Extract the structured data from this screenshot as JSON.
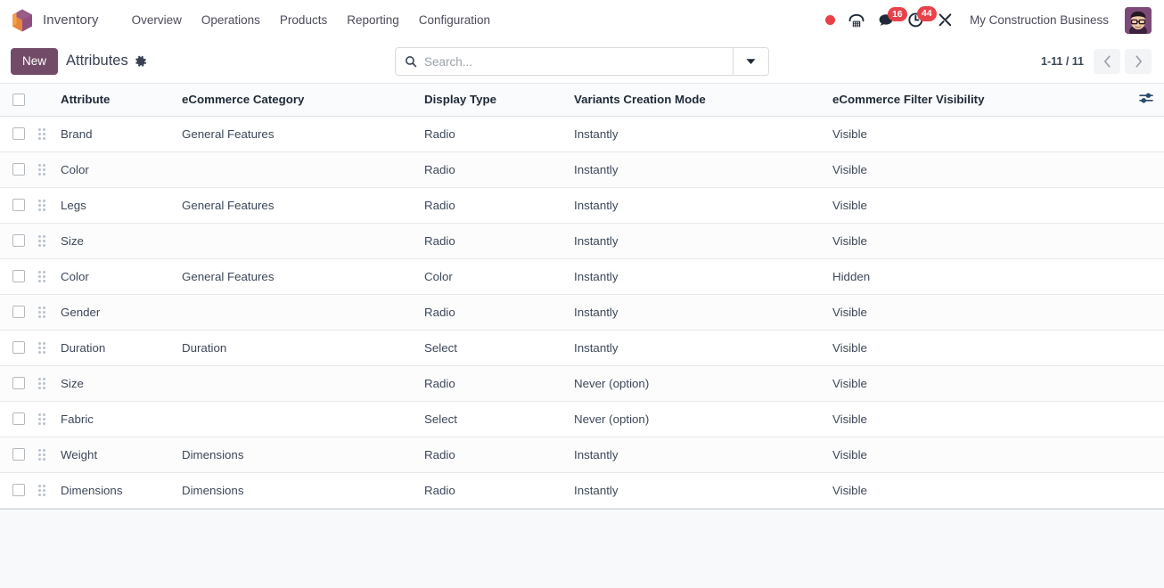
{
  "navbar": {
    "app_name": "Inventory",
    "logo_icon": "odoo-cube-logo",
    "menu": [
      {
        "label": "Overview"
      },
      {
        "label": "Operations"
      },
      {
        "label": "Products"
      },
      {
        "label": "Reporting"
      },
      {
        "label": "Configuration"
      }
    ],
    "systray": {
      "recording_icon": "record-dot-icon",
      "voip_icon": "phone-icon",
      "messaging_icon": "chat-bubble-icon",
      "messaging_count": "16",
      "activities_icon": "clock-icon",
      "activities_count": "44",
      "debug_icon": "wrench-tools-icon"
    },
    "company": "My Construction Business",
    "avatar_icon": "user-avatar"
  },
  "control_panel": {
    "new_label": "New",
    "title": "Attributes",
    "settings_icon": "gear-icon",
    "search": {
      "placeholder": "Search...",
      "value": "",
      "search_icon": "search-icon",
      "toggle_icon": "caret-down-icon"
    },
    "pager": {
      "range": "1-11 / 11",
      "prev_icon": "chevron-left-icon",
      "next_icon": "chevron-right-icon"
    }
  },
  "list": {
    "select_all_icon": "checkbox-unchecked",
    "optional_columns_icon": "sliders-adjust-icon",
    "columns": [
      {
        "key": "attribute",
        "label": "Attribute"
      },
      {
        "key": "category",
        "label": "eCommerce Category"
      },
      {
        "key": "display_type",
        "label": "Display Type"
      },
      {
        "key": "variants_mode",
        "label": "Variants Creation Mode"
      },
      {
        "key": "filter_visibility",
        "label": "eCommerce Filter Visibility"
      }
    ],
    "rows": [
      {
        "attribute": "Brand",
        "category": "General Features",
        "display_type": "Radio",
        "variants_mode": "Instantly",
        "filter_visibility": "Visible"
      },
      {
        "attribute": "Color",
        "category": "",
        "display_type": "Radio",
        "variants_mode": "Instantly",
        "filter_visibility": "Visible"
      },
      {
        "attribute": "Legs",
        "category": "General Features",
        "display_type": "Radio",
        "variants_mode": "Instantly",
        "filter_visibility": "Visible"
      },
      {
        "attribute": "Size",
        "category": "",
        "display_type": "Radio",
        "variants_mode": "Instantly",
        "filter_visibility": "Visible"
      },
      {
        "attribute": "Color",
        "category": "General Features",
        "display_type": "Color",
        "variants_mode": "Instantly",
        "filter_visibility": "Hidden"
      },
      {
        "attribute": "Gender",
        "category": "",
        "display_type": "Radio",
        "variants_mode": "Instantly",
        "filter_visibility": "Visible"
      },
      {
        "attribute": "Duration",
        "category": "Duration",
        "display_type": "Select",
        "variants_mode": "Instantly",
        "filter_visibility": "Visible"
      },
      {
        "attribute": "Size",
        "category": "",
        "display_type": "Radio",
        "variants_mode": "Never (option)",
        "filter_visibility": "Visible"
      },
      {
        "attribute": "Fabric",
        "category": "",
        "display_type": "Select",
        "variants_mode": "Never (option)",
        "filter_visibility": "Visible"
      },
      {
        "attribute": "Weight",
        "category": "Dimensions",
        "display_type": "Radio",
        "variants_mode": "Instantly",
        "filter_visibility": "Visible"
      },
      {
        "attribute": "Dimensions",
        "category": "Dimensions",
        "display_type": "Radio",
        "variants_mode": "Instantly",
        "filter_visibility": "Visible"
      }
    ],
    "row_handle_icon": "drag-handle-icon",
    "row_checkbox_icon": "checkbox-unchecked"
  },
  "colors": {
    "brand_purple": "#714B67",
    "badge_red": "#E8414A",
    "page_bg": "#F8F9FA",
    "surface": "#FFFFFF",
    "text": "#3C4858"
  }
}
